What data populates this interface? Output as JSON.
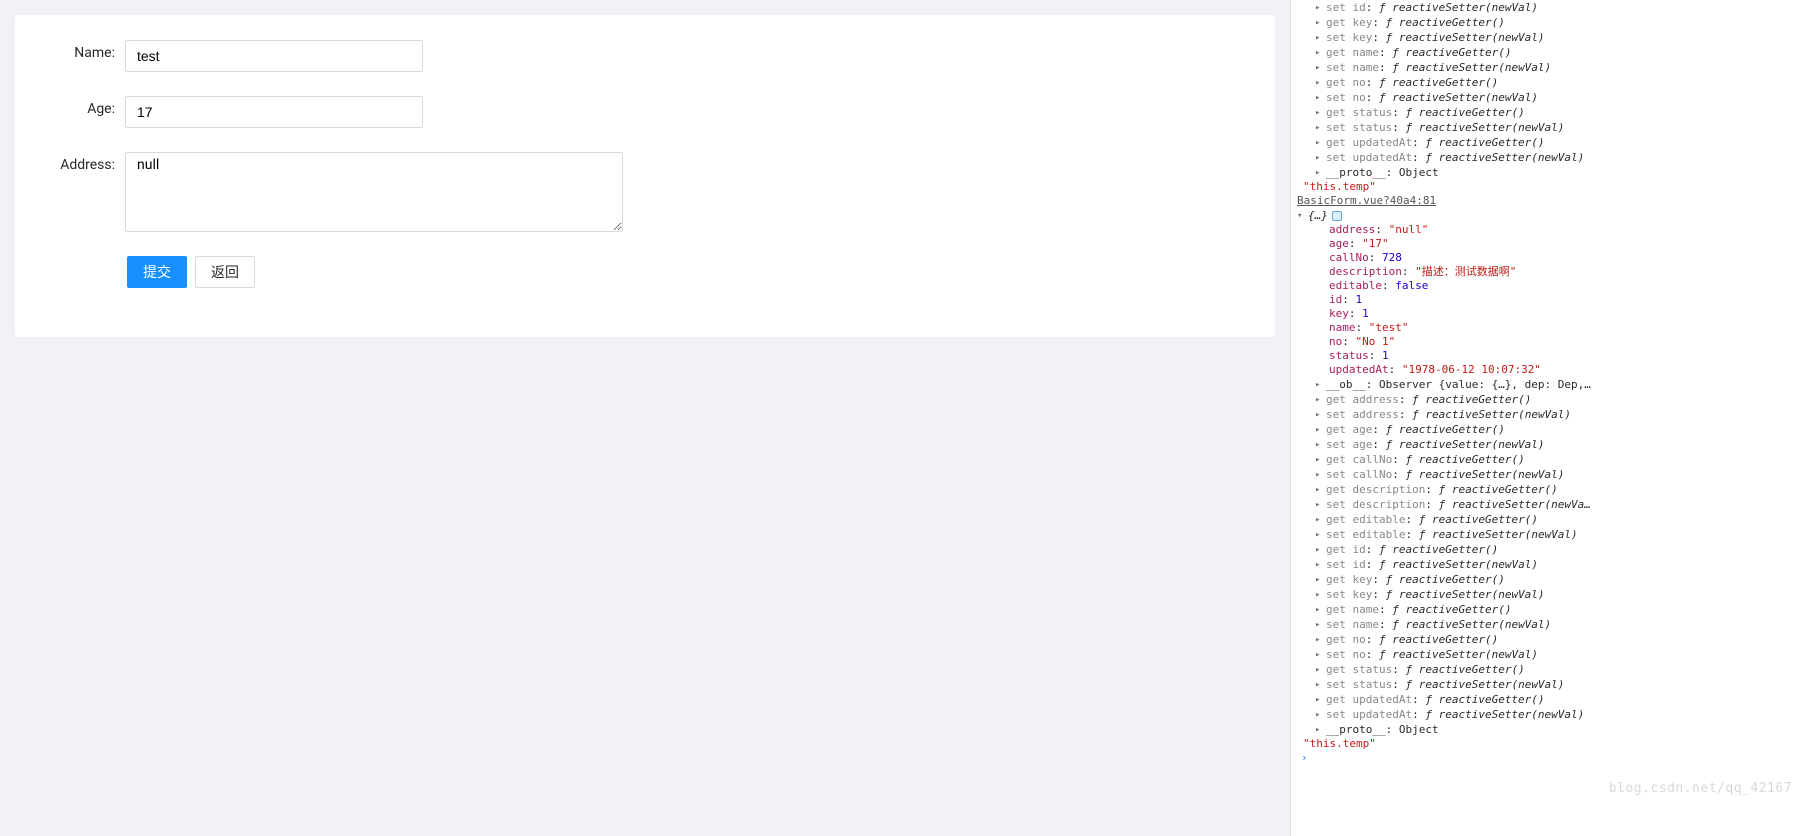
{
  "form": {
    "nameLabel": "Name:",
    "nameValue": "test",
    "ageLabel": "Age:",
    "ageValue": "17",
    "addressLabel": "Address:",
    "addressValue": "null",
    "submitLabel": "提交",
    "backLabel": "返回"
  },
  "console": {
    "topGetSet": [
      {
        "t": "set",
        "p": "id",
        "f": "reactiveSetter(newVal)"
      },
      {
        "t": "get",
        "p": "key",
        "f": "reactiveGetter()"
      },
      {
        "t": "set",
        "p": "key",
        "f": "reactiveSetter(newVal)"
      },
      {
        "t": "get",
        "p": "name",
        "f": "reactiveGetter()"
      },
      {
        "t": "set",
        "p": "name",
        "f": "reactiveSetter(newVal)"
      },
      {
        "t": "get",
        "p": "no",
        "f": "reactiveGetter()"
      },
      {
        "t": "set",
        "p": "no",
        "f": "reactiveSetter(newVal)"
      },
      {
        "t": "get",
        "p": "status",
        "f": "reactiveGetter()"
      },
      {
        "t": "set",
        "p": "status",
        "f": "reactiveSetter(newVal)"
      },
      {
        "t": "get",
        "p": "updatedAt",
        "f": "reactiveGetter()"
      },
      {
        "t": "set",
        "p": "updatedAt",
        "f": "reactiveSetter(newVal)"
      }
    ],
    "proto": "__proto__: Object",
    "thisTemp": "\"this.temp\"",
    "source": "BasicForm.vue?40a4:81",
    "objOpen": "{…}",
    "data": {
      "address": "\"null\"",
      "age": "\"17\"",
      "callNo": "728",
      "description": "\"描述：测试数据啊\"",
      "editable": "false",
      "id": "1",
      "key": "1",
      "name": "\"test\"",
      "no": "\"No 1\"",
      "status": "1",
      "updatedAt": "\"1978-06-12 10:07:32\""
    },
    "ob": "__ob__: Observer {value: {…}, dep: Dep,…",
    "bottomGetSet": [
      {
        "t": "get",
        "p": "address",
        "f": "reactiveGetter()"
      },
      {
        "t": "set",
        "p": "address",
        "f": "reactiveSetter(newVal)"
      },
      {
        "t": "get",
        "p": "age",
        "f": "reactiveGetter()"
      },
      {
        "t": "set",
        "p": "age",
        "f": "reactiveSetter(newVal)"
      },
      {
        "t": "get",
        "p": "callNo",
        "f": "reactiveGetter()"
      },
      {
        "t": "set",
        "p": "callNo",
        "f": "reactiveSetter(newVal)"
      },
      {
        "t": "get",
        "p": "description",
        "f": "reactiveGetter()"
      },
      {
        "t": "set",
        "p": "description",
        "f": "reactiveSetter(newVa…"
      },
      {
        "t": "get",
        "p": "editable",
        "f": "reactiveGetter()"
      },
      {
        "t": "set",
        "p": "editable",
        "f": "reactiveSetter(newVal)"
      },
      {
        "t": "get",
        "p": "id",
        "f": "reactiveGetter()"
      },
      {
        "t": "set",
        "p": "id",
        "f": "reactiveSetter(newVal)"
      },
      {
        "t": "get",
        "p": "key",
        "f": "reactiveGetter()"
      },
      {
        "t": "set",
        "p": "key",
        "f": "reactiveSetter(newVal)"
      },
      {
        "t": "get",
        "p": "name",
        "f": "reactiveGetter()"
      },
      {
        "t": "set",
        "p": "name",
        "f": "reactiveSetter(newVal)"
      },
      {
        "t": "get",
        "p": "no",
        "f": "reactiveGetter()"
      },
      {
        "t": "set",
        "p": "no",
        "f": "reactiveSetter(newVal)"
      },
      {
        "t": "get",
        "p": "status",
        "f": "reactiveGetter()"
      },
      {
        "t": "set",
        "p": "status",
        "f": "reactiveSetter(newVal)"
      },
      {
        "t": "get",
        "p": "updatedAt",
        "f": "reactiveGetter()"
      },
      {
        "t": "set",
        "p": "updatedAt",
        "f": "reactiveSetter(newVal)"
      }
    ],
    "prompt": "›"
  },
  "watermark": "blog.csdn.net/qq_42167"
}
